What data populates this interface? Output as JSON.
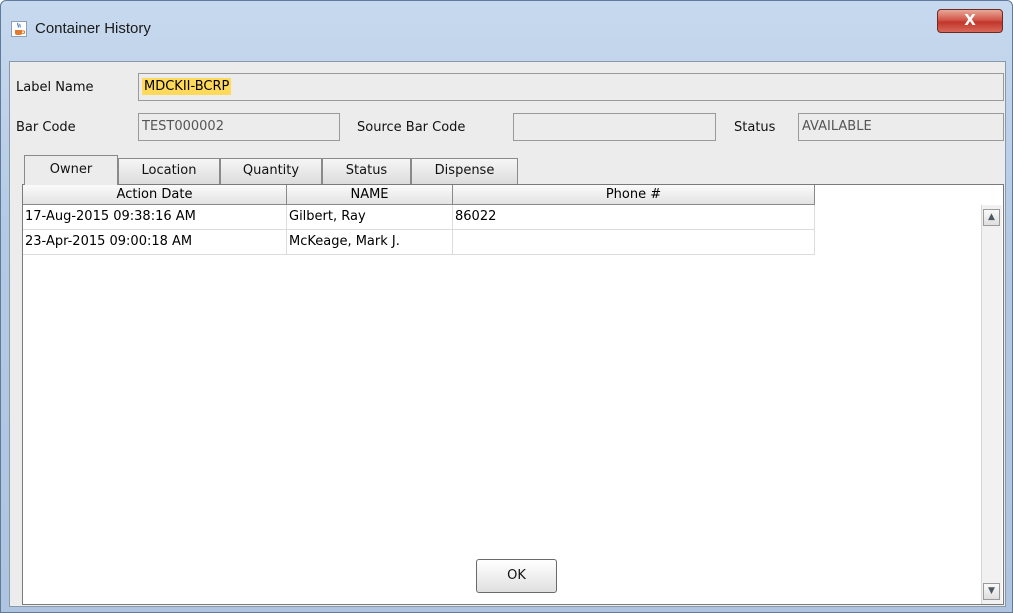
{
  "window": {
    "title": "Container History",
    "close_label": "X"
  },
  "form": {
    "label_name_label": "Label Name",
    "label_name_value": "MDCKII-BCRP",
    "bar_code_label": "Bar Code",
    "bar_code_value": "TEST000002",
    "source_bar_code_label": "Source Bar Code",
    "source_bar_code_value": "",
    "status_label": "Status",
    "status_value": "AVAILABLE"
  },
  "tabs": [
    {
      "label": "Owner",
      "active": true
    },
    {
      "label": "Location",
      "active": false
    },
    {
      "label": "Quantity",
      "active": false
    },
    {
      "label": "Status",
      "active": false
    },
    {
      "label": "Dispense",
      "active": false
    }
  ],
  "table": {
    "columns": [
      "Action Date",
      "NAME",
      "Phone #"
    ],
    "rows": [
      [
        "17-Aug-2015 09:38:16 AM",
        "Gilbert, Ray",
        "86022"
      ],
      [
        "23-Apr-2015 09:00:18 AM",
        "McKeage, Mark J.",
        ""
      ]
    ]
  },
  "footer": {
    "ok_label": "OK"
  },
  "colors": {
    "highlight": "#ffd95a",
    "close_button": "#c1362a",
    "title_bar": "#b3c9e4"
  },
  "icons": {
    "app_icon": "java-cup-icon",
    "scroll_up": "triangle-up-icon",
    "scroll_down": "triangle-down-icon"
  }
}
